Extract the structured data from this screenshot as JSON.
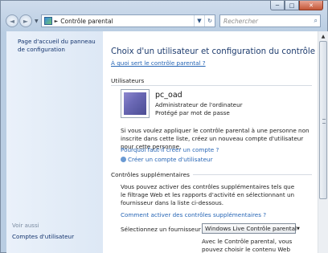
{
  "window": {
    "caption": {
      "minimize": "─",
      "maximize": "□",
      "close": "✕"
    }
  },
  "nav": {
    "back_icon": "◄",
    "forward_icon": "►",
    "breadcrumb_separator": "►",
    "breadcrumb": "Contrôle parental",
    "refresh_icon": "↻",
    "search_placeholder": "Rechercher",
    "search_icon": "⌕"
  },
  "sidebar": {
    "home_link": "Page d'accueil du panneau de configuration",
    "see_also": "Voir aussi",
    "user_accounts": "Comptes d'utilisateur"
  },
  "main": {
    "title": "Choix d'un utilisateur et configuration du contrôle parental",
    "what_is_link": "À quoi sert le contrôle parental ?",
    "users_section": "Utilisateurs",
    "user": {
      "name": "pc_oad",
      "role": "Administrateur de l'ordinateur",
      "protection": "Protégé par mot de passe"
    },
    "create_text": "Si vous voulez appliquer le contrôle parental à une personne non inscrite dans cette liste, créez un nouveau compte d'utilisateur pour cette personne.",
    "why_create_link": "Pourquoi faut-il créer un compte ?",
    "create_account_link": "Créer un compte d'utilisateur",
    "extra_section": "Contrôles supplémentaires",
    "extra_text": "Vous pouvez activer des contrôles supplémentaires tels que le filtrage Web et les rapports d'activité en sélectionnant un fournisseur dans la liste ci-dessous.",
    "how_enable_link": "Comment activer des contrôles supplémentaires ?",
    "provider_label": "Sélectionnez un fournisseur :",
    "provider_value": "Windows Live Contrôle parental",
    "provider_note_1": "Avec le Contrôle parental, vous",
    "provider_note_2": "pouvez choisir le contenu Web"
  }
}
